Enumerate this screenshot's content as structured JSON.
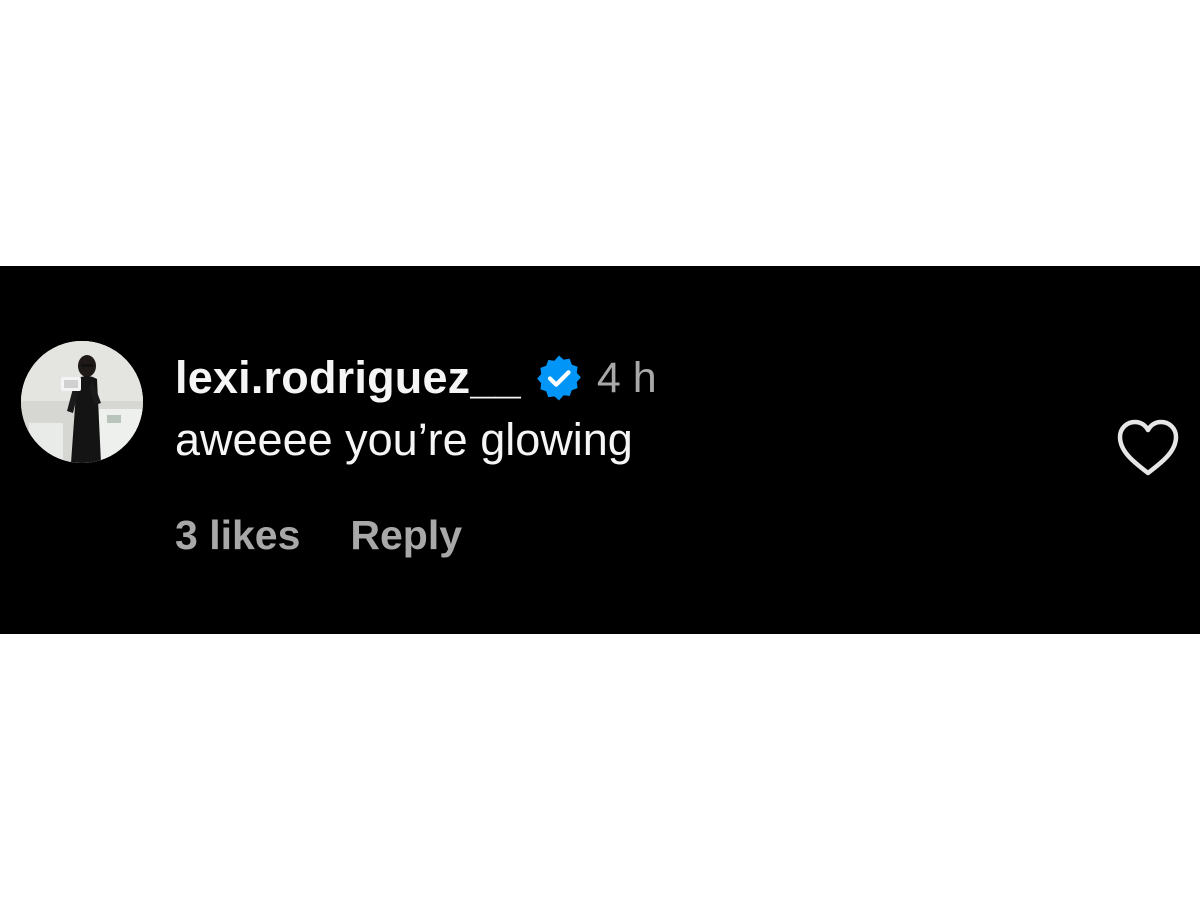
{
  "comment": {
    "username": "lexi.rodriguez__",
    "verified": true,
    "timestamp": "4 h",
    "text": "aweeee you’re glowing",
    "likes": "3 likes",
    "reply_label": "Reply"
  },
  "icons": {
    "verified": "verified-badge-icon",
    "like": "heart-outline-icon",
    "avatar": "profile-photo"
  },
  "colors": {
    "comment_background": "#000000",
    "page_background": "#ffffff",
    "primary_text": "#f5f5f5",
    "secondary_text": "#a8a8a8",
    "verified_badge": "#0095f6"
  }
}
